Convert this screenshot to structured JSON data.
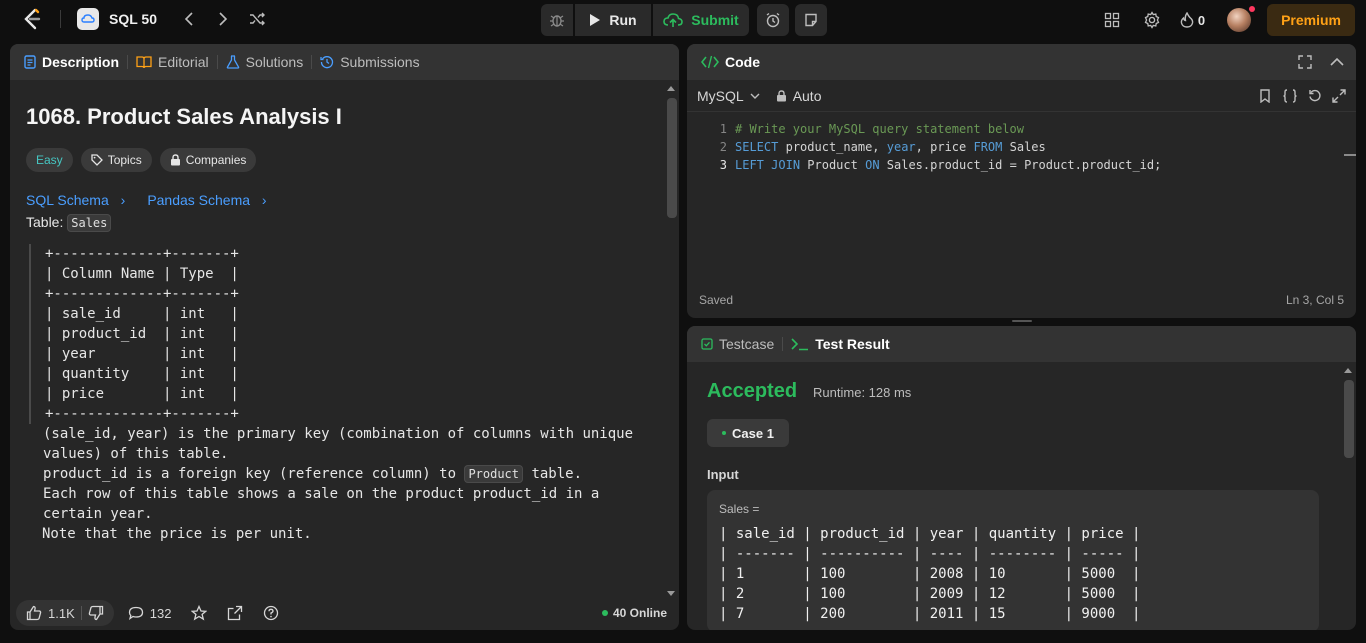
{
  "topbar": {
    "list_title": "SQL 50",
    "run_label": "Run",
    "submit_label": "Submit",
    "streak_count": "0",
    "premium_label": "Premium"
  },
  "description": {
    "tabs": [
      "Description",
      "Editorial",
      "Solutions",
      "Submissions"
    ],
    "title": "1068. Product Sales Analysis I",
    "badges": {
      "difficulty": "Easy",
      "topics": "Topics",
      "companies": "Companies"
    },
    "schema_links": [
      "SQL Schema",
      "Pandas Schema"
    ],
    "table_label": "Table:",
    "table_name": "Sales",
    "schema_table": "+-------------+-------+\n| Column Name | Type  |\n+-------------+-------+\n| sale_id     | int   |\n| product_id  | int   |\n| year        | int   |\n| quantity    | int   |\n| price       | int   |\n+-------------+-------+",
    "text_line1": "(sale_id, year) is the primary key (combination of columns with unique values) of this table.",
    "text_line2_pre": "product_id is a foreign key (reference column) to ",
    "text_line2_chip": "Product",
    "text_line2_post": " table.",
    "text_line3": "Each row of this table shows a sale on the product product_id in a certain year.",
    "text_line4": "Note that the price is per unit.",
    "footer": {
      "likes": "1.1K",
      "comments": "132",
      "online": "40 Online"
    }
  },
  "code": {
    "header": "Code",
    "language": "MySQL",
    "mode": "Auto",
    "lines": [
      {
        "num": "1",
        "text": "# Write your MySQL query statement below"
      },
      {
        "num": "2",
        "text": "SELECT product_name, year, price FROM Sales"
      },
      {
        "num": "3",
        "text": "LEFT JOIN Product ON Sales.product_id = Product.product_id;"
      }
    ],
    "status_left": "Saved",
    "status_right": "Ln 3, Col 5"
  },
  "result": {
    "tabs": [
      "Testcase",
      "Test Result"
    ],
    "status": "Accepted",
    "runtime": "Runtime: 128 ms",
    "case_label": "Case 1",
    "input_label": "Input",
    "input_name": "Sales =",
    "input_table": "| sale_id | product_id | year | quantity | price |\n| ------- | ---------- | ---- | -------- | ----- |\n| 1       | 100        | 2008 | 10       | 5000  |\n| 2       | 100        | 2009 | 12       | 5000  |\n| 7       | 200        | 2011 | 15       | 9000  |"
  },
  "colors": {
    "accent_green": "#2cbb5d",
    "premium_orange": "#ffa116",
    "link_blue": "#4a9eff",
    "easy_teal": "#46c6c2"
  }
}
